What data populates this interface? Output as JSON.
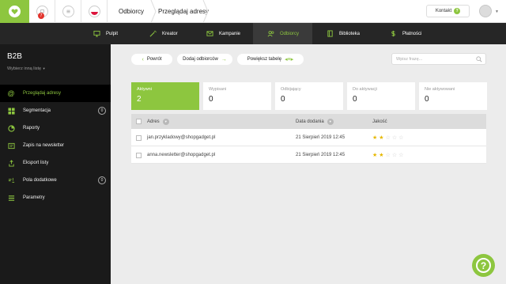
{
  "topbar": {
    "notification_count": "7",
    "breadcrumb": [
      "Odbiorcy",
      "Przeglądaj adresy"
    ],
    "contact_label": "Kontakt",
    "contact_icon": "?"
  },
  "modules": [
    {
      "label": "Pulpit",
      "icon": "monitor-icon"
    },
    {
      "label": "Kreator",
      "icon": "wand-icon"
    },
    {
      "label": "Kampanie",
      "icon": "envelope-icon"
    },
    {
      "label": "Odbiorcy",
      "icon": "users-icon",
      "active": true
    },
    {
      "label": "Biblioteka",
      "icon": "book-icon"
    },
    {
      "label": "Płatności",
      "icon": "dollar-icon"
    }
  ],
  "sidebar": {
    "title": "B2B",
    "subtitle": "Wybierz inną listę",
    "items": [
      {
        "label": "Przeglądaj adresy",
        "icon": "at-icon",
        "active": true
      },
      {
        "label": "Segmentacja",
        "icon": "grid-icon",
        "count": "0"
      },
      {
        "label": "Raporty",
        "icon": "pie-chart-icon"
      },
      {
        "label": "Zapis na newsletter",
        "icon": "signup-icon"
      },
      {
        "label": "Eksport listy",
        "icon": "export-icon"
      },
      {
        "label": "Pola dodatkowe",
        "icon": "fields-icon",
        "count": "0"
      },
      {
        "label": "Parametry",
        "icon": "list-icon"
      }
    ]
  },
  "toolbar": {
    "back_label": "Powrót",
    "add_label": "Dodaj odbiorców",
    "enlarge_label": "Powiększ tabelę",
    "search_placeholder": "Wpisz frazę..."
  },
  "stats": [
    {
      "label": "Aktywni",
      "value": "2",
      "active": true
    },
    {
      "label": "Wypisani",
      "value": "0"
    },
    {
      "label": "Odbijający",
      "value": "0"
    },
    {
      "label": "Do aktywacji",
      "value": "0"
    },
    {
      "label": "Nie aktywowani",
      "value": "0"
    }
  ],
  "table": {
    "columns": [
      "Adres",
      "Data dodania",
      "Jakość"
    ],
    "rows": [
      {
        "email": "jan.przykladowy@shopgadget.pl",
        "date": "21 Sierpień 2019 12:45",
        "quality": 2
      },
      {
        "email": "anna.newsletter@shopgadget.pl",
        "date": "21 Sierpień 2019 12:45",
        "quality": 2
      }
    ],
    "max_quality": 5
  },
  "colors": {
    "accent": "#8dc63f",
    "sidebar_bg": "#1a1a1a",
    "nav_bg": "#262626",
    "badge_red": "#e2342d",
    "star": "#e6b800"
  }
}
